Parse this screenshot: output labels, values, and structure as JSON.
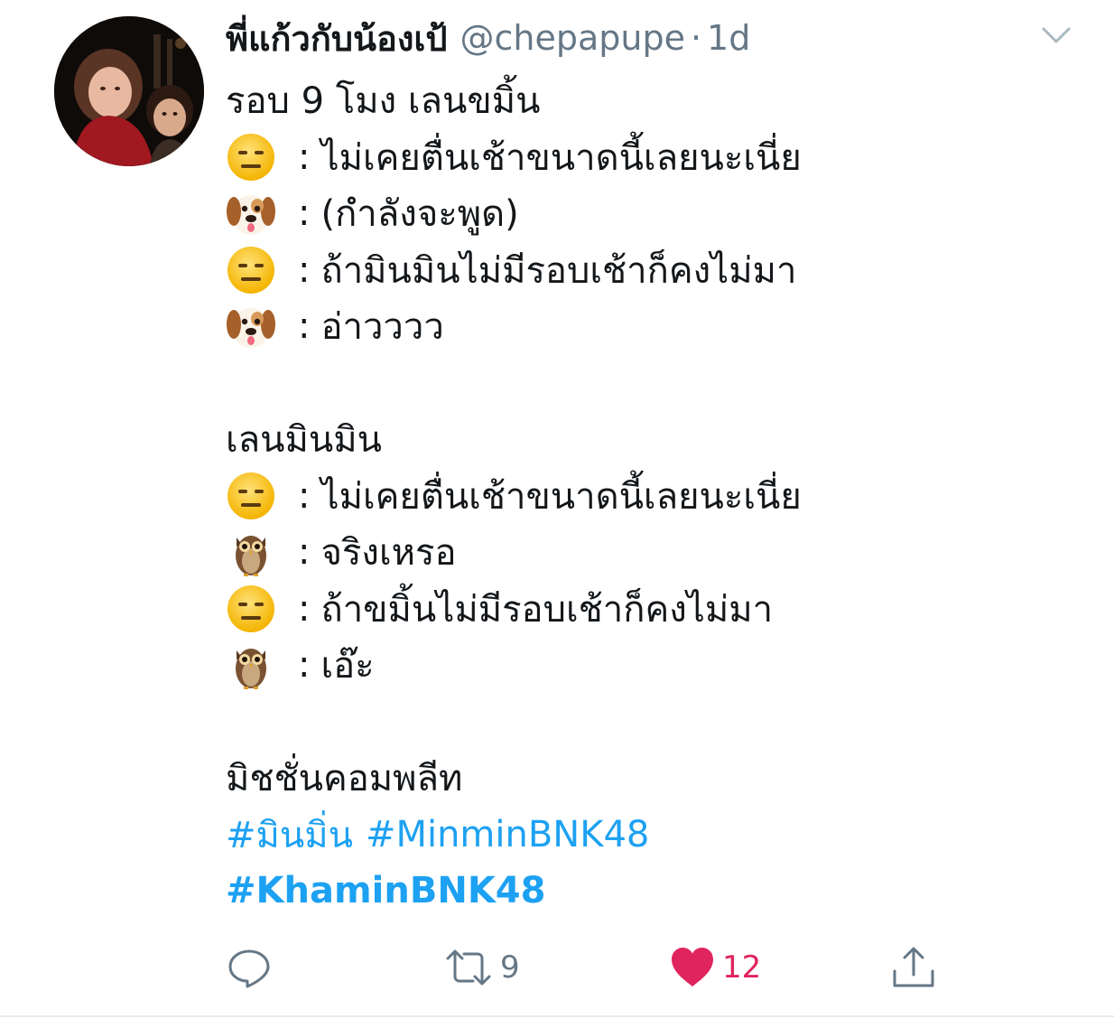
{
  "tweet": {
    "display_name": "พี่แก้วกับน้องเป้",
    "handle": "@chepapupe",
    "separator": "·",
    "time": "1d",
    "lines": [
      {
        "type": "text",
        "text": "รอบ 9 โมง เลนขมิ้น"
      },
      {
        "type": "dialog",
        "emoji": "expressionless-face",
        "text": "ไม่เคยตื่นเช้าขนาดนี้เลยนะเนี่ย"
      },
      {
        "type": "dialog",
        "emoji": "dog-face",
        "text": "(กำลังจะพูด)"
      },
      {
        "type": "dialog",
        "emoji": "expressionless-face",
        "text": "ถ้ามินมินไม่มีรอบเช้าก็คงไม่มา"
      },
      {
        "type": "dialog",
        "emoji": "dog-face",
        "text": "อ่าวววว"
      },
      {
        "type": "blank"
      },
      {
        "type": "text",
        "text": "เลนมินมิน"
      },
      {
        "type": "dialog",
        "emoji": "expressionless-face",
        "text": "ไม่เคยตื่นเช้าขนาดนี้เลยนะเนี่ย"
      },
      {
        "type": "dialog",
        "emoji": "owl",
        "text": "จริงเหรอ"
      },
      {
        "type": "dialog",
        "emoji": "expressionless-face",
        "text": "ถ้าขมิ้นไม่มีรอบเช้าก็คงไม่มา"
      },
      {
        "type": "dialog",
        "emoji": "owl",
        "text": "เอ๊ะ"
      },
      {
        "type": "blank"
      },
      {
        "type": "text",
        "text": "มิชชั่นคอมพลีท"
      }
    ],
    "colon": ":",
    "hashtags": [
      "#มินมิ่น",
      "#MinminBNK48",
      "#KhaminBNK48"
    ]
  },
  "actions": {
    "reply_icon": "reply-icon",
    "retweet_icon": "retweet-icon",
    "retweet_count": "9",
    "like_icon": "heart-icon",
    "like_count": "12",
    "share_icon": "share-icon"
  },
  "colors": {
    "link": "#1da1f2",
    "muted": "#657786",
    "like": "#e0245e",
    "text": "#14171a"
  }
}
